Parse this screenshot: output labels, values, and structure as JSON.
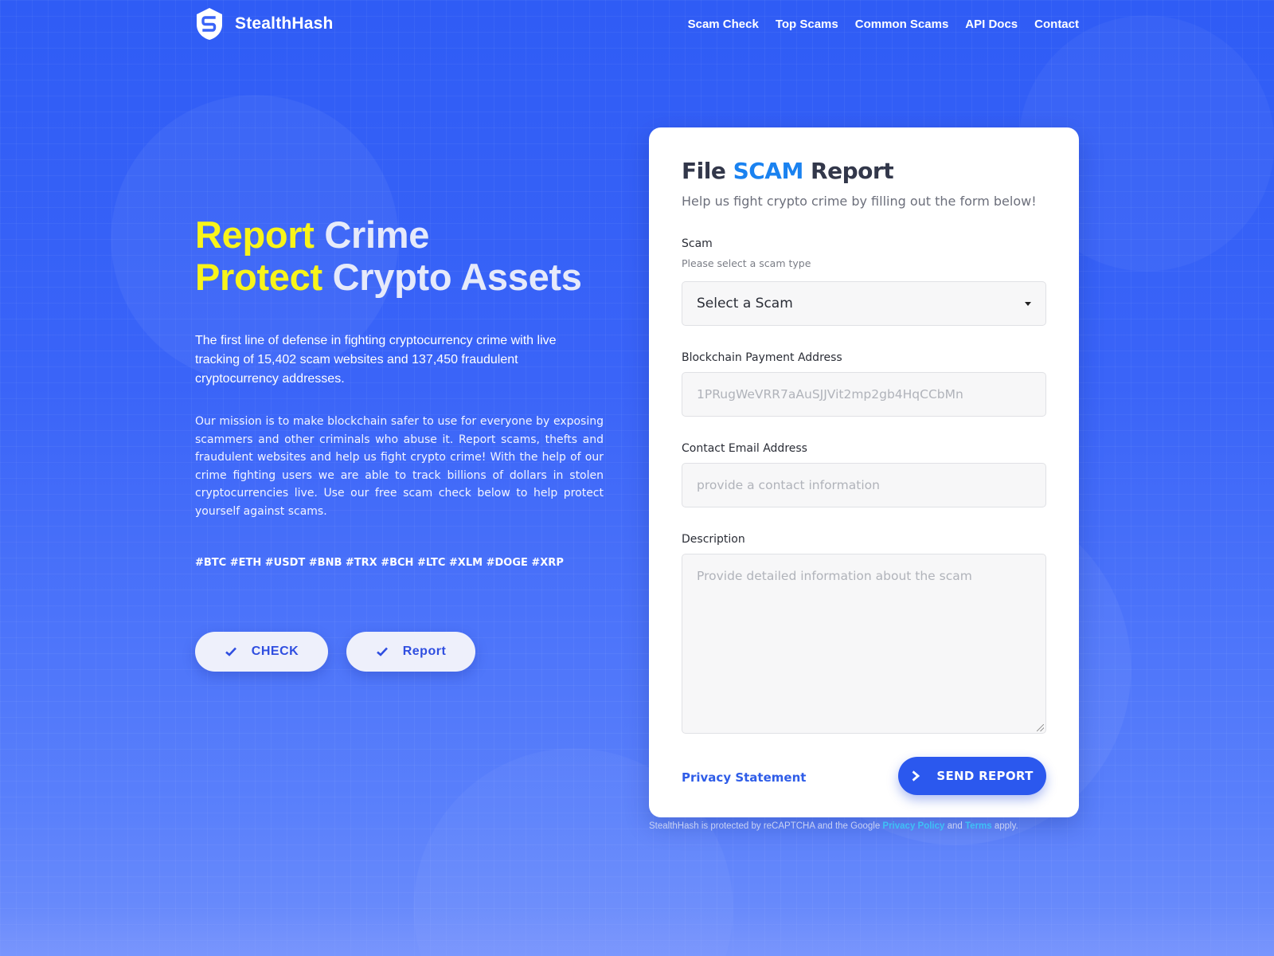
{
  "brand": {
    "name": "StealthHash",
    "logo_icon": "shield-s-logo"
  },
  "nav": {
    "items": [
      "Scam Check",
      "Top Scams",
      "Common Scams",
      "API Docs",
      "Contact"
    ]
  },
  "hero": {
    "line1_highlight": "Report",
    "line1_rest": " Crime",
    "line2_highlight": "Protect",
    "line2_rest": " Crypto Assets",
    "lead": "The first line of defense in fighting cryptocurrency crime with live tracking of 15,402 scam websites and 137,450 fraudulent cryptocurrency addresses.",
    "mission": "Our mission is to make blockchain safer to use for everyone by exposing scammers and other criminals who abuse it. Report scams, thefts and fraudulent websites and help us fight crypto crime! With the help of our crime fighting users we are able to track billions of dollars in stolen cryptocurrencies live. Use our free scam check below to help protect yourself against scams.",
    "tags": "#BTC #ETH #USDT #BNB #TRX #BCH #LTC #XLM #DOGE #XRP",
    "check_label": "CHECK",
    "report_label": "Report"
  },
  "form": {
    "title_pre": "File ",
    "title_accent": "SCAM",
    "title_post": " Report",
    "subtitle": "Help us fight crypto crime by filling out the form below!",
    "scam_label": "Scam",
    "scam_hint": "Please select a scam type",
    "scam_selected": "Select a Scam",
    "address_label": "Blockchain Payment Address",
    "address_placeholder": "1PRugWeVRR7aAuSJJVit2mp2gb4HqCCbMn",
    "email_label": "Contact Email Address",
    "email_placeholder": "provide a contact information",
    "description_label": "Description",
    "description_placeholder": "Provide detailed information about the scam",
    "privacy_label": "Privacy Statement",
    "send_label": "SEND REPORT"
  },
  "recaptcha": {
    "prefix": "StealthHash is protected by reCAPTCHA and the Google ",
    "privacy": "Privacy Policy",
    "and": " and ",
    "terms": "Terms",
    "suffix": " apply."
  },
  "colors": {
    "background": "#3a64f8",
    "highlight_yellow": "#f8f41a",
    "accent_blue": "#1a82f0",
    "button_blue": "#2b58ee"
  }
}
